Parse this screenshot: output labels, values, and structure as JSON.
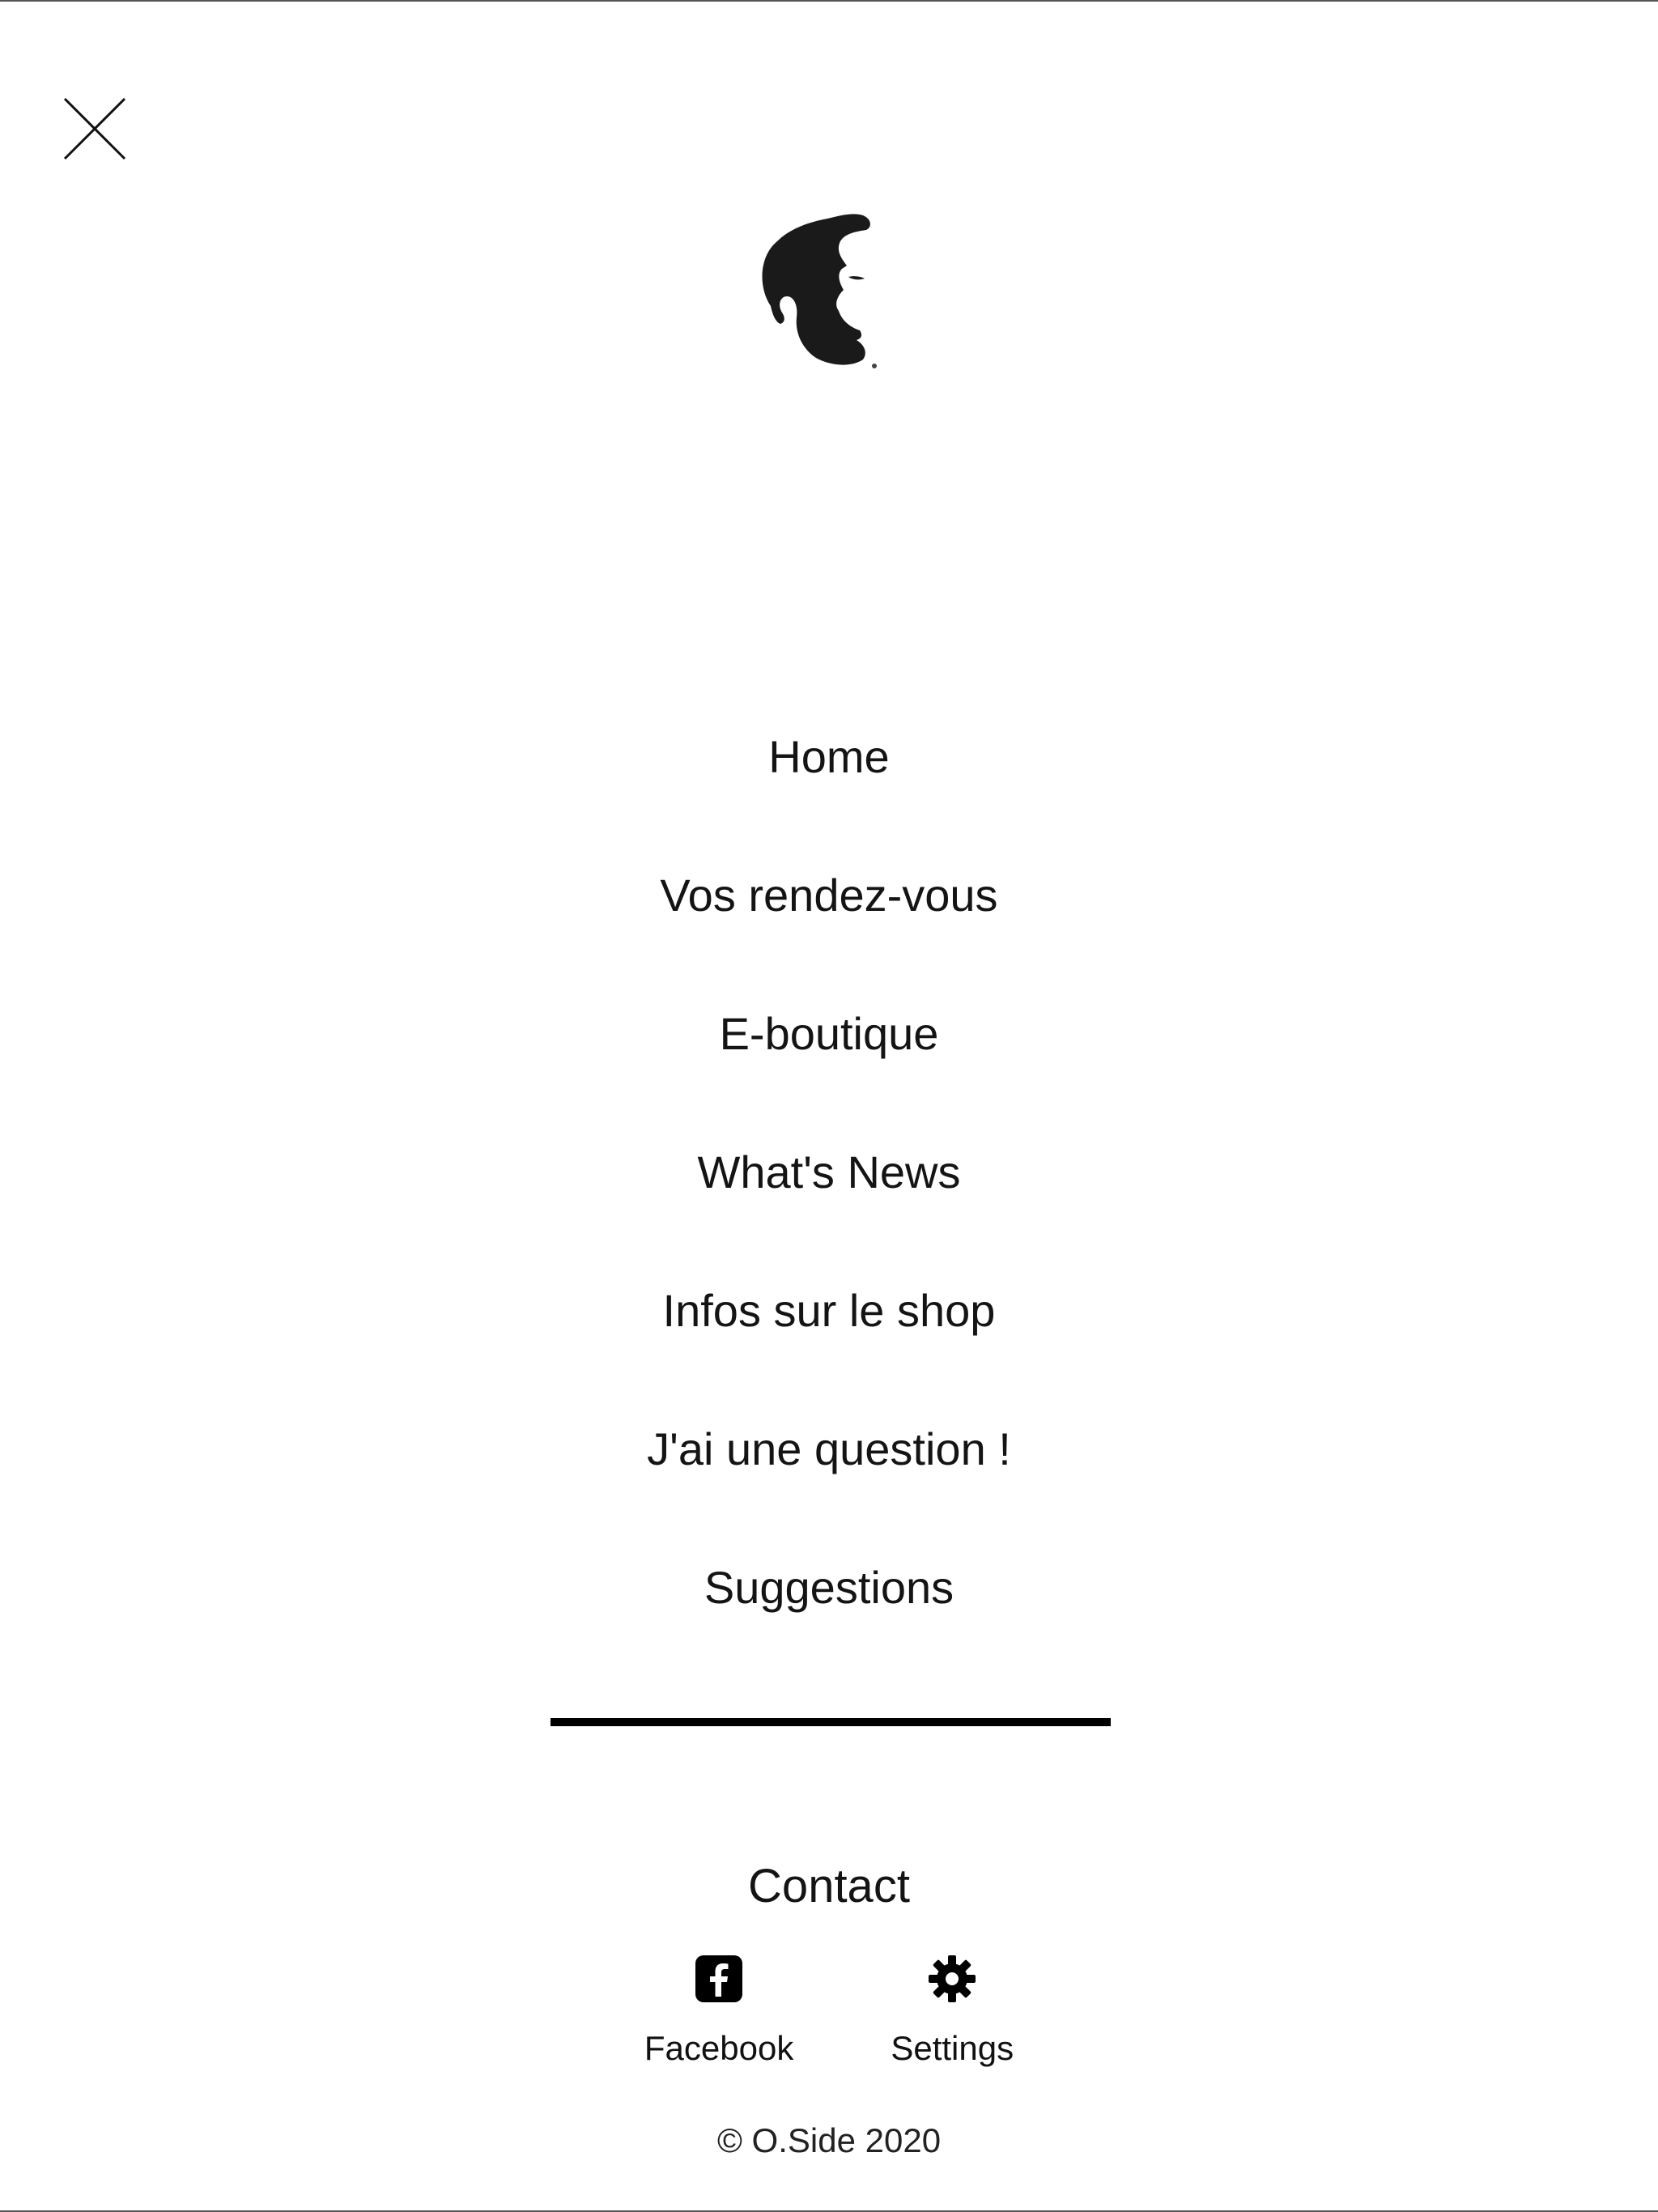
{
  "menu": {
    "items": [
      {
        "label": "Home"
      },
      {
        "label": "Vos rendez-vous"
      },
      {
        "label": "E-boutique"
      },
      {
        "label": "What's News"
      },
      {
        "label": "Infos sur le shop"
      },
      {
        "label": "J'ai une question !"
      },
      {
        "label": "Suggestions"
      }
    ]
  },
  "contact": {
    "label": "Contact"
  },
  "footer": {
    "links": [
      {
        "label": "Facebook",
        "icon": "facebook-icon"
      },
      {
        "label": "Settings",
        "icon": "gear-icon"
      }
    ],
    "copyright": "© O.Side 2020"
  },
  "colors": {
    "background": "#ffffff",
    "text": "#141414",
    "divider": "#000000"
  }
}
